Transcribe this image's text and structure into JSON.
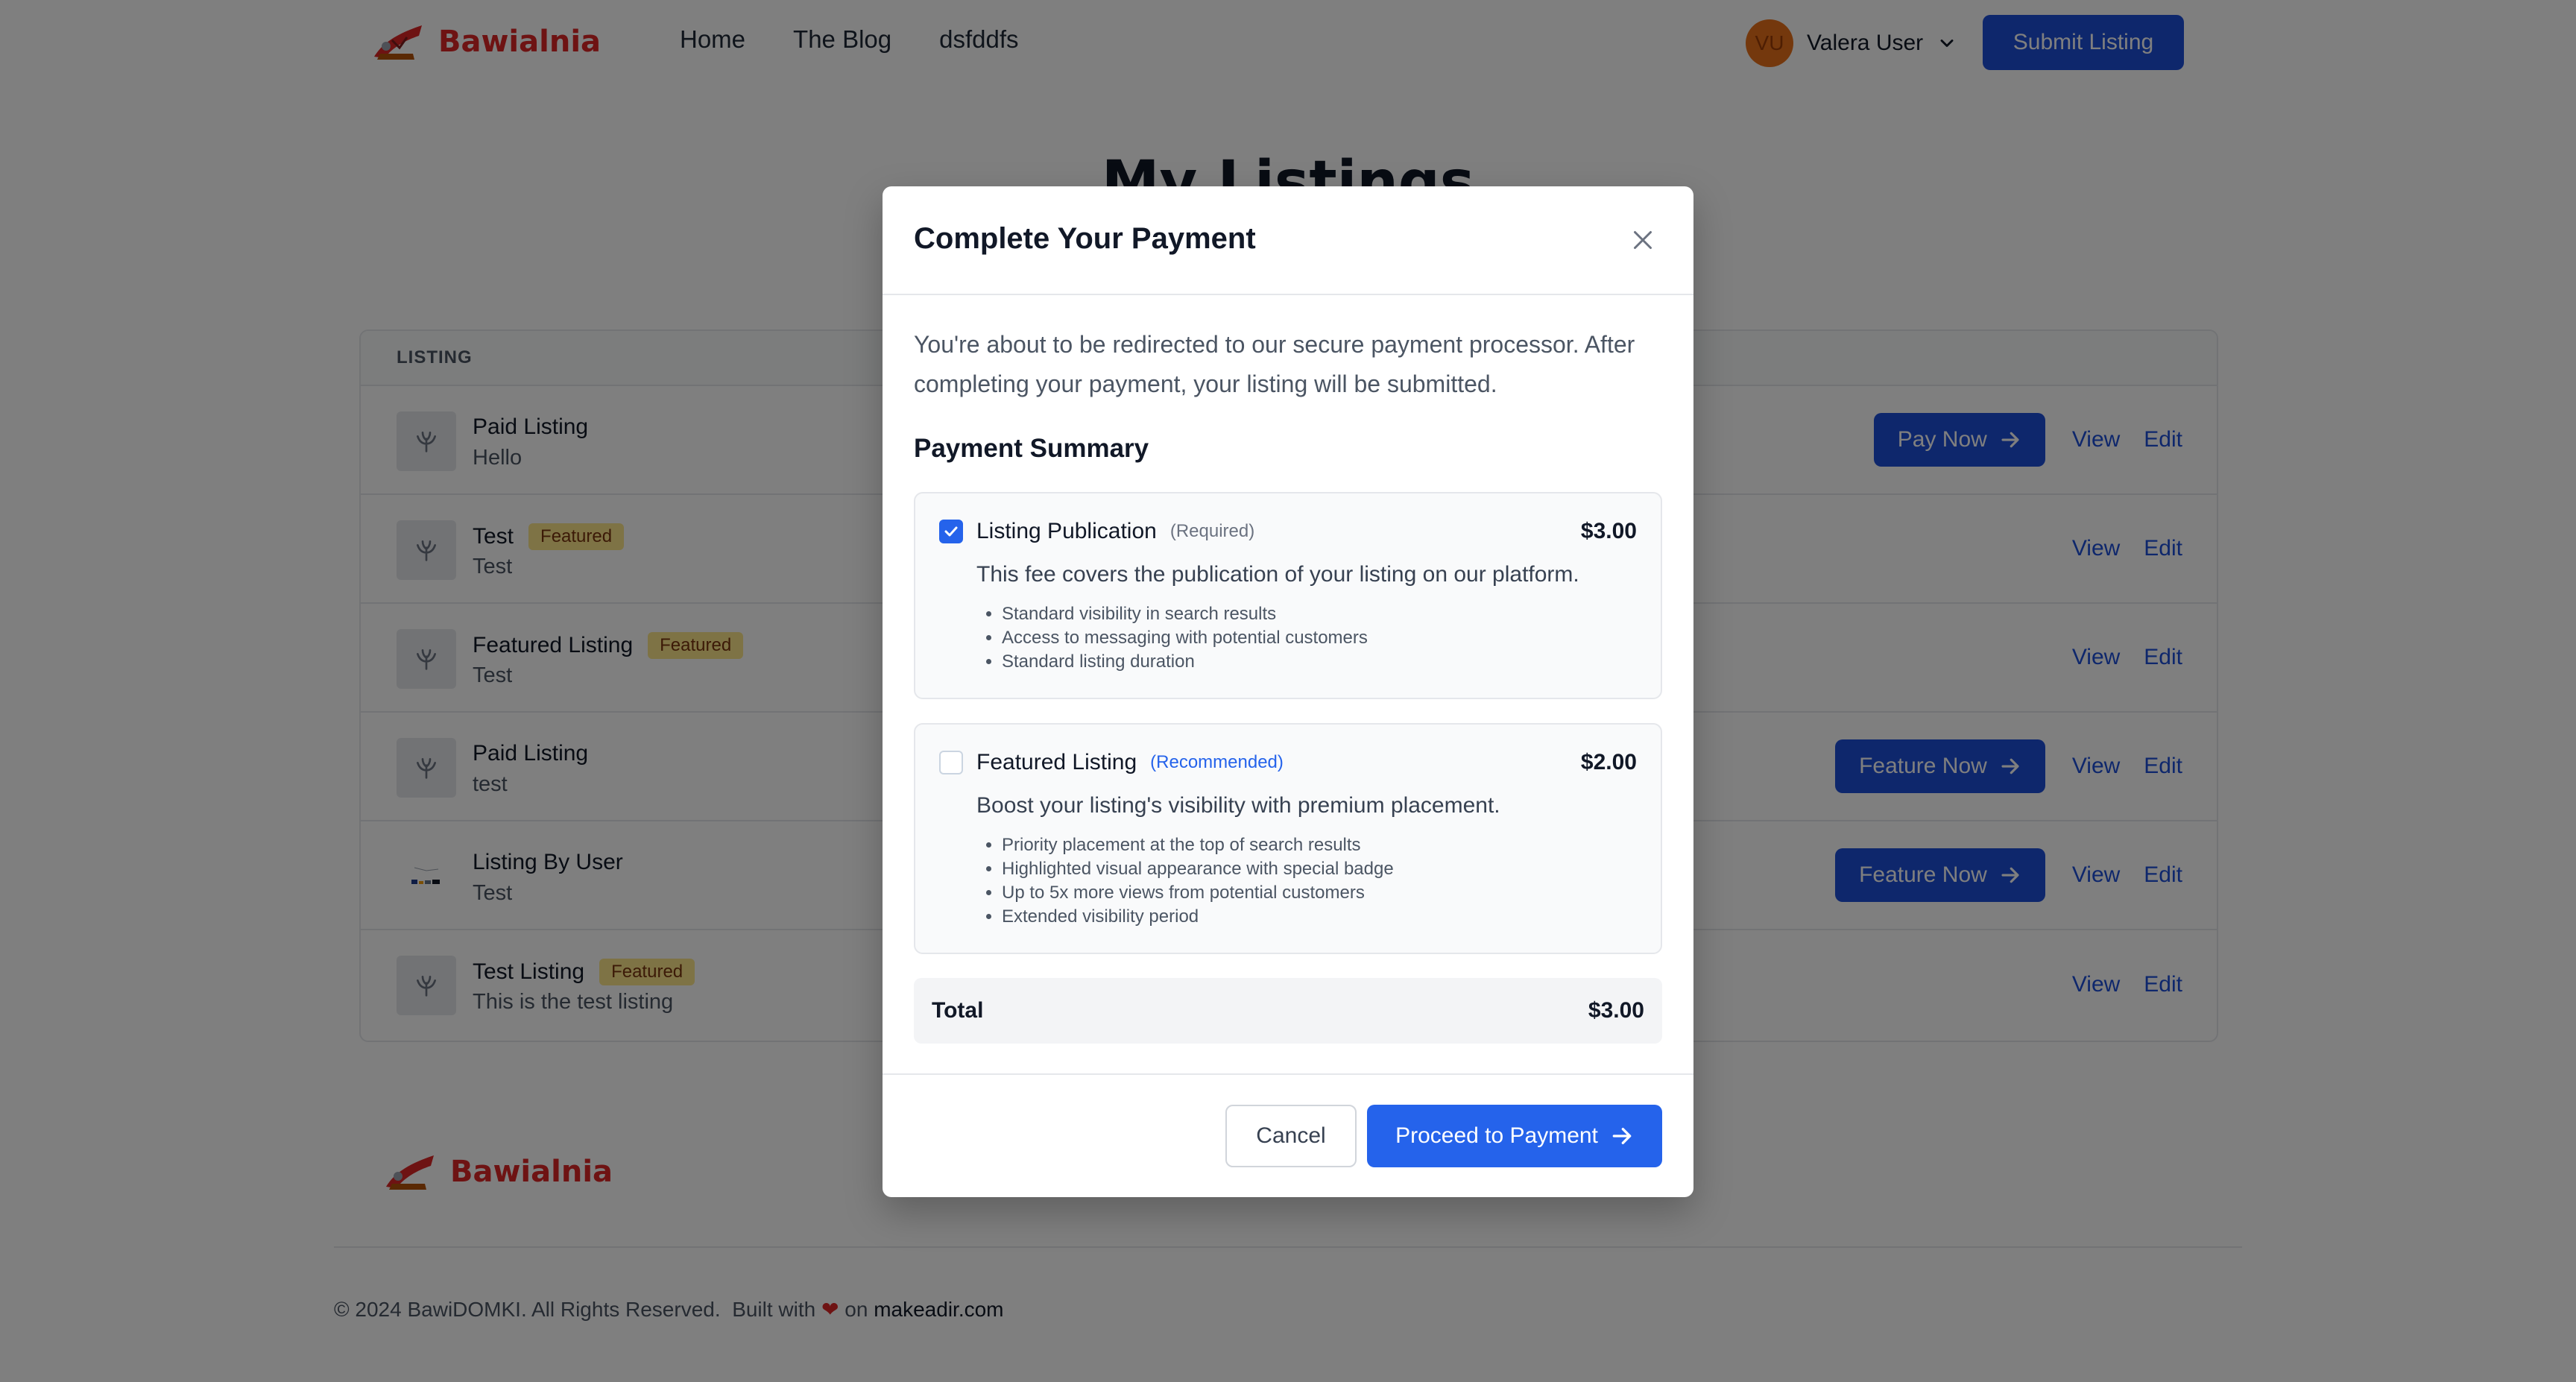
{
  "header": {
    "logo_text": "Bawialnia",
    "nav": [
      "Home",
      "The Blog",
      "dsfddfs"
    ],
    "user_initials": "VU",
    "user_name": "Valera User",
    "submit_label": "Submit Listing"
  },
  "page": {
    "title": "My Listings"
  },
  "table": {
    "column_header": "LISTING",
    "rows": [
      {
        "title": "Paid Listing",
        "subtitle": "Hello",
        "badge": "",
        "action": "Pay Now",
        "view": "View",
        "edit": "Edit",
        "thumb": "placeholder"
      },
      {
        "title": "Test",
        "subtitle": "Test",
        "badge": "Featured",
        "action": "",
        "view": "View",
        "edit": "Edit",
        "thumb": "placeholder"
      },
      {
        "title": "Featured Listing",
        "subtitle": "Test",
        "badge": "Featured",
        "action": "",
        "view": "View",
        "edit": "Edit",
        "thumb": "placeholder"
      },
      {
        "title": "Paid Listing",
        "subtitle": "test",
        "badge": "",
        "action": "Feature Now",
        "view": "View",
        "edit": "Edit",
        "thumb": "placeholder"
      },
      {
        "title": "Listing By User",
        "subtitle": "Test",
        "badge": "",
        "action": "Feature Now",
        "view": "View",
        "edit": "Edit",
        "thumb": "image"
      },
      {
        "title": "Test Listing",
        "subtitle": "This is the test listing",
        "badge": "Featured",
        "action": "",
        "view": "View",
        "edit": "Edit",
        "thumb": "placeholder"
      }
    ]
  },
  "footer": {
    "logo_text": "Bawialnia",
    "copyright": "© 2024 BawiDOMKI. All Rights Reserved.",
    "built_with": "Built with",
    "on": "on",
    "site": "makeadir.com"
  },
  "modal": {
    "title": "Complete Your Payment",
    "intro": "You're about to be redirected to our secure payment processor. After completing your payment, your listing will be submitted.",
    "summary_title": "Payment Summary",
    "items": [
      {
        "name": "Listing Publication",
        "tag": "(Required)",
        "price": "$3.00",
        "checked": true,
        "description": "This fee covers the publication of your listing on our platform.",
        "features": [
          "Standard visibility in search results",
          "Access to messaging with potential customers",
          "Standard listing duration"
        ]
      },
      {
        "name": "Featured Listing",
        "tag": "(Recommended)",
        "price": "$2.00",
        "checked": false,
        "description": "Boost your listing's visibility with premium placement.",
        "features": [
          "Priority placement at the top of search results",
          "Highlighted visual appearance with special badge",
          "Up to 5x more views from potential customers",
          "Extended visibility period"
        ]
      }
    ],
    "total_label": "Total",
    "total_value": "$3.00",
    "cancel_label": "Cancel",
    "proceed_label": "Proceed to Payment"
  },
  "colors": {
    "primary": "#2563eb",
    "brand_red": "#dc2626",
    "badge_bg": "#fde68a",
    "overlay": "rgba(0,0,0,0.5)"
  }
}
